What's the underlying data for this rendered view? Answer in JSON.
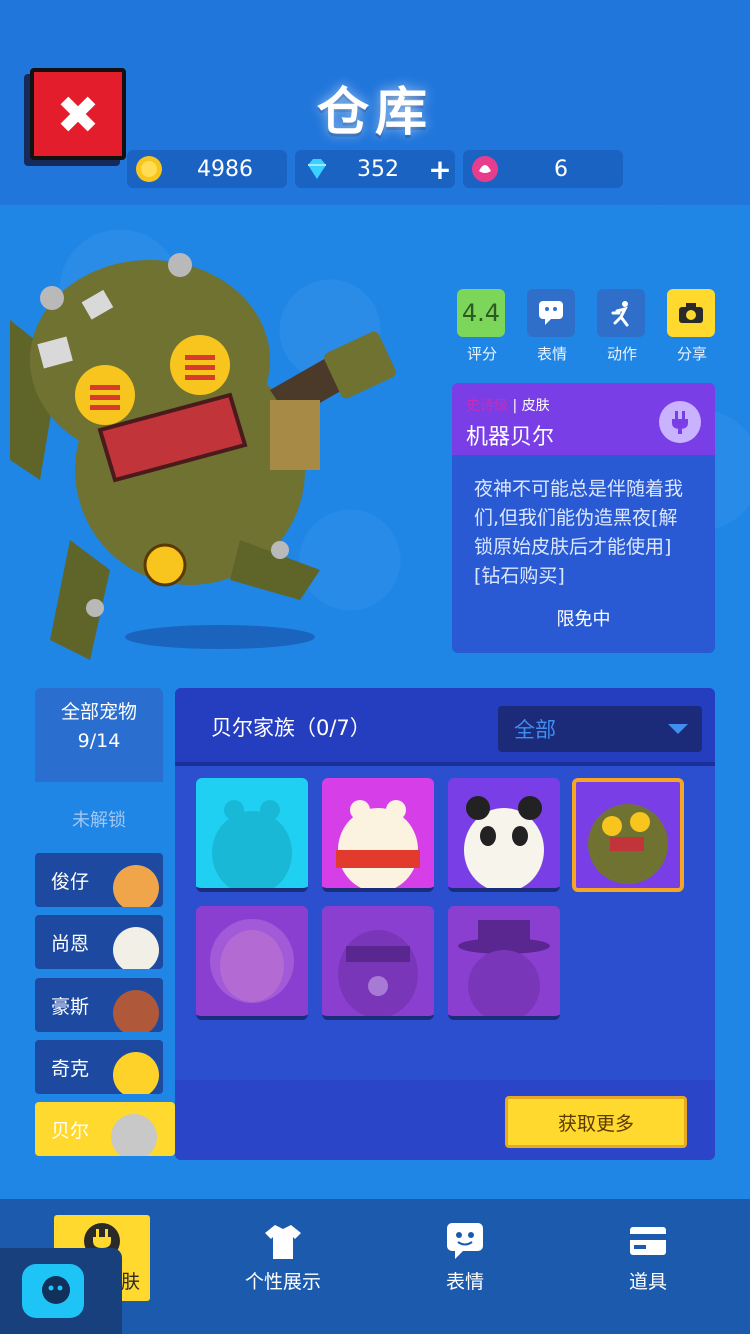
{
  "header": {
    "title": "仓库",
    "currencies": [
      {
        "icon": "gold-coin-icon",
        "value": "4986"
      },
      {
        "icon": "diamond-icon",
        "value": "352",
        "plus": "+"
      },
      {
        "icon": "lotus-token-icon",
        "value": "6"
      }
    ]
  },
  "actions": [
    {
      "label": "评分",
      "value": "4.4"
    },
    {
      "label": "表情"
    },
    {
      "label": "动作"
    },
    {
      "label": "分享"
    }
  ],
  "skin_info": {
    "rarity": "史诗级",
    "type": "皮肤",
    "name": "机器贝尔",
    "description": "夜神不可能总是伴随着我们,但我们能伪造黑夜[解锁原始皮肤后才能使用][钻石购买]",
    "status": "限免中"
  },
  "sidebar": {
    "all_pets_label": "全部宠物",
    "all_pets_count": "9/14",
    "locked_label": "未解锁",
    "items": [
      {
        "label": "俊仔"
      },
      {
        "label": "尚恩"
      },
      {
        "label": "豪斯"
      },
      {
        "label": "奇克"
      },
      {
        "label": "贝尔"
      }
    ]
  },
  "panel": {
    "title": "贝尔家族（0/7）",
    "filter_value": "全部",
    "get_more_label": "获取更多"
  },
  "bottom_nav": [
    {
      "label": "宠物皮肤"
    },
    {
      "label": "个性展示"
    },
    {
      "label": "表情"
    },
    {
      "label": "道具"
    }
  ],
  "colors": {
    "background": "#1f86e6",
    "accent_yellow": "#ffd92e",
    "close_red": "#e31d2b",
    "epic_purple": "#7a3ee6"
  }
}
